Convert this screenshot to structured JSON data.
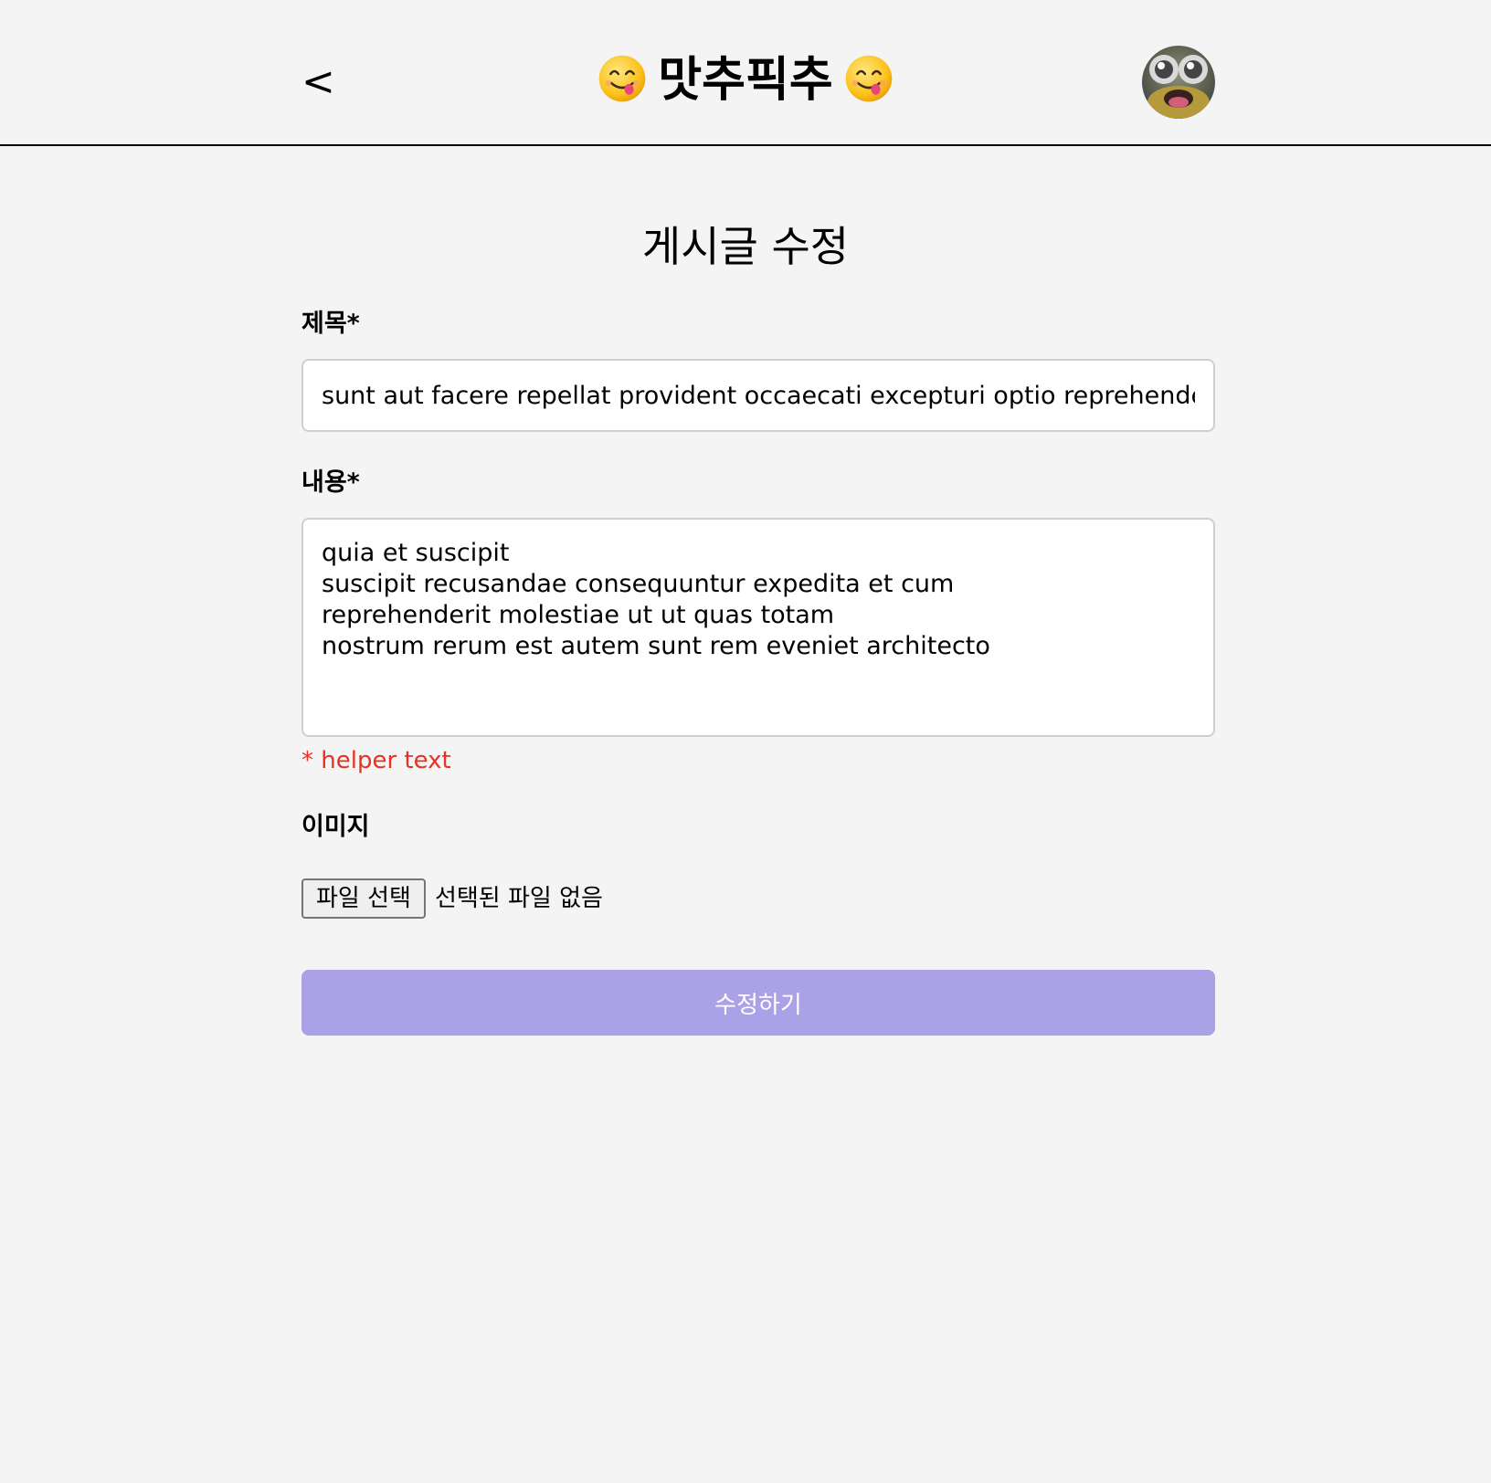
{
  "header": {
    "back_label": "<",
    "brand_title": "맛추픽추",
    "brand_emoji_left": "yum-face-emoji",
    "brand_emoji_right": "yum-face-emoji",
    "avatar_icon": "profile-avatar"
  },
  "page": {
    "title": "게시글 수정"
  },
  "form": {
    "title_label": "제목*",
    "title_value": "sunt aut facere repellat provident occaecati excepturi optio reprehenderit",
    "content_label": "내용*",
    "content_value": "quia et suscipit\nsuscipit recusandae consequuntur expedita et cum\nreprehenderit molestiae ut ut quas totam\nnostrum rerum est autem sunt rem eveniet architecto",
    "helper_text": "* helper text",
    "image_label": "이미지",
    "file_button_label": "파일 선택",
    "file_status": "선택된 파일 없음",
    "submit_label": "수정하기"
  },
  "colors": {
    "background": "#f4f4f4",
    "submit_button": "#aaa1e6",
    "helper_text": "#e53222",
    "input_border": "#cfcfcf"
  }
}
